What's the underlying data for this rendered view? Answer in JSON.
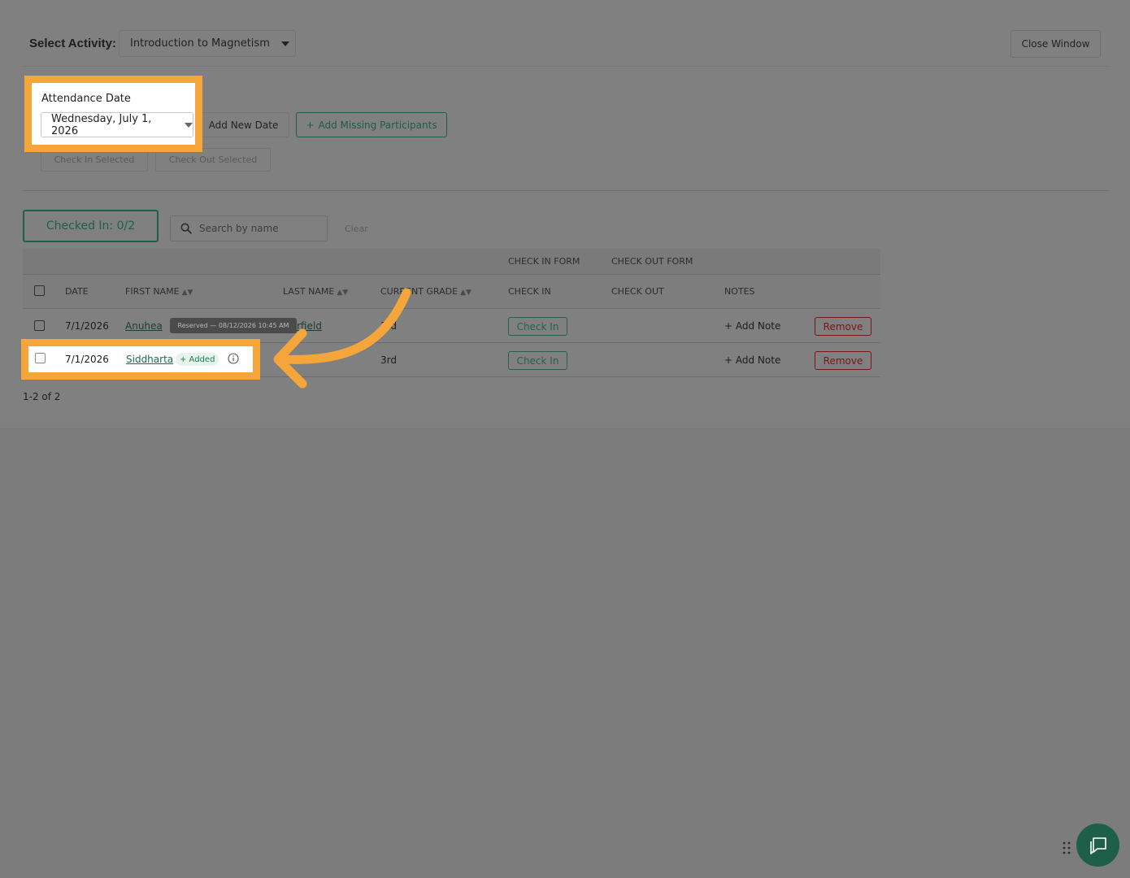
{
  "header": {
    "select_activity_label": "Select Activity:",
    "activity_value": "Introduction to Magnetism",
    "close_window": "Close Window"
  },
  "attendance": {
    "label": "Attendance Date",
    "date_value": "Wednesday, July 1, 2026",
    "add_new_date": "Add New Date",
    "add_missing_participants": "Add Missing Participants",
    "add_missing_icon": "+",
    "check_in_selected": "Check In Selected",
    "check_out_selected": "Check Out Selected"
  },
  "filters": {
    "checked_in": "Checked In: 0/2",
    "search_placeholder": "Search by name",
    "clear": "Clear"
  },
  "table": {
    "group_headers": {
      "check_in_form": "CHECK IN FORM",
      "check_out_form": "CHECK OUT FORM"
    },
    "columns": {
      "date": "DATE",
      "first_name": "FIRST NAME",
      "last_name": "LAST NAME",
      "current_grade": "CURRENT GRADE",
      "check_in": "CHECK IN",
      "check_out": "CHECK OUT",
      "notes": "NOTES"
    },
    "sort_glyph": "▲▼",
    "rows": [
      {
        "date": "7/1/2026",
        "first_name": "Anuhea",
        "last_name": "Fairfield",
        "last_name_visible": "rfield",
        "grade": "3rd",
        "check_in": "Check In",
        "notes": "+ Add Note",
        "remove": "Remove"
      },
      {
        "date": "7/1/2026",
        "first_name": "Siddharta",
        "added_badge": "+ Added",
        "grade": "3rd",
        "check_in": "Check In",
        "notes": "+ Add Note",
        "remove": "Remove"
      }
    ],
    "tooltip": "Reserved — 08/12/2026 10:45 AM",
    "pagination": "1-2 of 2"
  },
  "colors": {
    "highlight": "#f5a63b",
    "brand_green": "#1f5e49",
    "danger": "#7a1616"
  },
  "icons": {
    "search": "search-icon",
    "info": "info-icon",
    "chat": "chat-icon",
    "caret": "caret-down-icon",
    "grip": "drag-grip-icon"
  }
}
